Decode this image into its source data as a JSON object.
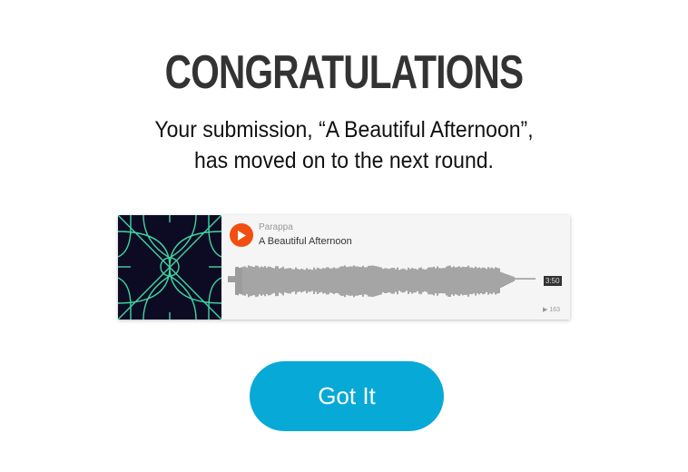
{
  "dialog": {
    "title": "CONGRATULATIONS",
    "message_line1": "Your submission, “A Beautiful Afternoon”,",
    "message_line2": "has moved on to the next round."
  },
  "player": {
    "artist": "Parappa",
    "track_title": "A Beautiful Afternoon",
    "duration": "3:50",
    "play_count": "163",
    "play_icon": "play-icon",
    "colors": {
      "play_button": "#f24e10",
      "artwork_bg": "#0d0b24",
      "artwork_lines": "#3fd6a0",
      "waveform": "#555555"
    }
  },
  "actions": {
    "got_it_label": "Got It",
    "button_color": "#07a9d7"
  }
}
